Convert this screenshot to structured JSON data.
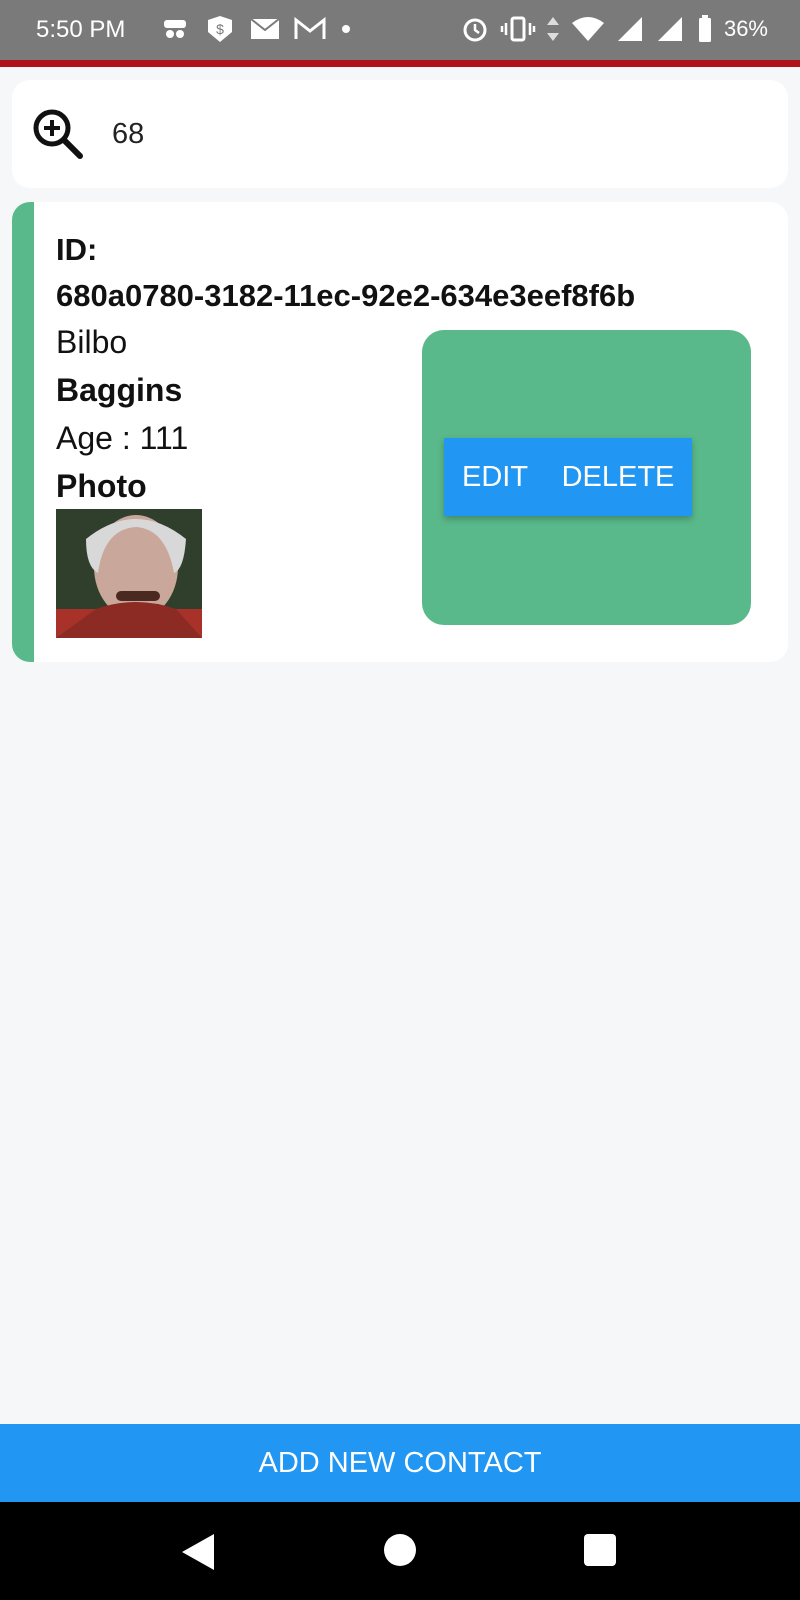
{
  "status_bar": {
    "time": "5:50 PM",
    "battery": "36%",
    "left_icons": [
      "incognito-icon",
      "shield-dollar-icon",
      "mail-icon",
      "gmail-icon",
      "dot-icon"
    ],
    "right_icons": [
      "alarm-icon",
      "vibrate-icon",
      "data-arrows-icon",
      "wifi-icon",
      "signal-icon",
      "signal-icon",
      "battery-icon"
    ]
  },
  "search": {
    "value": "68",
    "icon": "zoom-in-icon"
  },
  "contact": {
    "id_label": "ID:",
    "id_value": "680a0780-3182-11ec-92e2-634e3eef8f6b",
    "first_name": "Bilbo",
    "last_name": "Baggins",
    "age": "Age : 111",
    "photo_label": "Photo",
    "edit_label": "EDIT",
    "delete_label": "DELETE"
  },
  "add_button_label": "ADD NEW CONTACT",
  "colors": {
    "accent_green": "#59b98a",
    "button_blue": "#2196f3",
    "status_red": "#b0121b"
  }
}
